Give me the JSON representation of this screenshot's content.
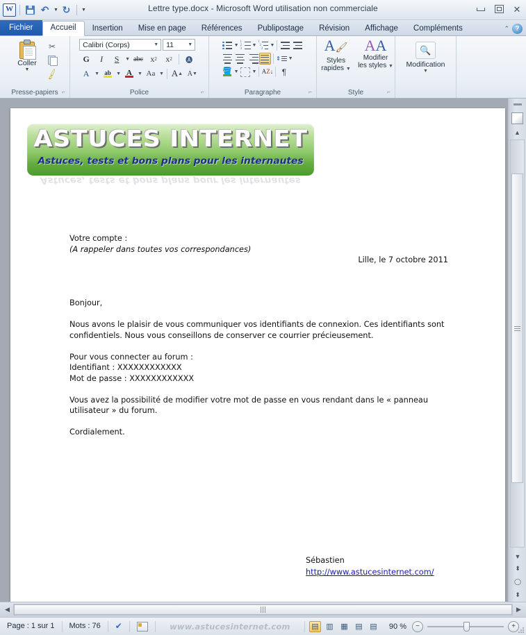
{
  "window": {
    "title": "Lettre type.docx  -  Microsoft Word utilisation non commerciale",
    "app_logo": "word-logo",
    "qat": [
      {
        "name": "save",
        "icon": "save-icon",
        "label": "Enregistrer"
      },
      {
        "name": "undo",
        "icon": "undo-icon",
        "label": "Annuler"
      },
      {
        "name": "redo",
        "icon": "redo-icon",
        "label": "Répéter"
      },
      {
        "name": "customize",
        "icon": "chevron-down-icon",
        "label": "Personnaliser"
      }
    ],
    "controls": {
      "minimize": "—",
      "restore": "❐",
      "close": "✕"
    }
  },
  "tabs": [
    {
      "id": "fichier",
      "label": "Fichier",
      "active": false,
      "file": true
    },
    {
      "id": "accueil",
      "label": "Accueil",
      "active": true
    },
    {
      "id": "insertion",
      "label": "Insertion",
      "active": false
    },
    {
      "id": "mise-en-page",
      "label": "Mise en page",
      "active": false
    },
    {
      "id": "references",
      "label": "Références",
      "active": false
    },
    {
      "id": "publipostage",
      "label": "Publipostage",
      "active": false
    },
    {
      "id": "revision",
      "label": "Révision",
      "active": false
    },
    {
      "id": "affichage",
      "label": "Affichage",
      "active": false
    },
    {
      "id": "complements",
      "label": "Compléments",
      "active": false
    }
  ],
  "help_icon": "?",
  "ribbon": {
    "clipboard": {
      "label": "Presse-papiers",
      "paste": "Coller",
      "cut": "cut-icon",
      "copy": "copy-icon",
      "format_painter": "format-painter-icon"
    },
    "font": {
      "label": "Police",
      "font_name": "Calibri (Corps)",
      "font_size": "11",
      "bold": "G",
      "italic": "I",
      "underline": "S",
      "strikethrough": "abc",
      "subscript": "x₂",
      "superscript": "x²",
      "clear_format": "clear-formatting-icon",
      "text_effects": "A",
      "highlight": "ab",
      "font_color": "A",
      "change_case": "Aa",
      "grow_font": "A",
      "shrink_font": "A"
    },
    "paragraph": {
      "label": "Paragraphe",
      "bullets": "bullet-list-icon",
      "numbering": "numbered-list-icon",
      "multilevel": "multilevel-list-icon",
      "decrease_indent": "decrease-indent-icon",
      "increase_indent": "increase-indent-icon",
      "align_left": "align-left-icon",
      "align_center": "align-center-icon",
      "align_right": "align-right-icon",
      "justify": "justify-icon",
      "line_spacing": "line-spacing-icon",
      "shading": "shading-icon",
      "borders": "borders-icon",
      "sort": "sort-icon",
      "show_marks": "¶"
    },
    "style": {
      "label": "Style",
      "quick_styles_l1": "Styles",
      "quick_styles_l2": "rapides",
      "change_styles_l1": "Modifier",
      "change_styles_l2": "les styles"
    },
    "editing": {
      "label": "",
      "modification": "Modification",
      "icon": "binoculars-icon"
    }
  },
  "document": {
    "logo": {
      "title": "ASTUCES INTERNET",
      "tagline": "Astuces, tests et bons plans pour les internautes"
    },
    "account_line1": "Votre compte :",
    "account_line2": "(A rappeler dans toutes vos correspondances)",
    "date": "Lille, le 7 octobre 2011",
    "greeting": "Bonjour,",
    "para1": "Nous avons le plaisir de vous communiquer vos identifiants de connexion. Ces identifiants sont confidentiels. Nous vous conseillons de conserver ce courrier précieusement.",
    "connect_intro": "Pour vous connecter au forum :",
    "login_line": "Identifiant : XXXXXXXXXXXX",
    "password_line": "Mot de passe : XXXXXXXXXXXX",
    "para2": "Vous avez la possibilité de modifier votre mot de passe en vous rendant dans le « panneau utilisateur » du forum.",
    "closing": "Cordialement.",
    "signature_name": "Sébastien",
    "signature_url": "http://www.astucesinternet.com/"
  },
  "status": {
    "page": "Page : 1 sur 1",
    "words": "Mots : 76",
    "spell_icon": "spell-check-icon",
    "language_icon": "language-icon",
    "watermark": "www.astucesinternet.com",
    "views": [
      {
        "name": "print-layout",
        "icon": "▤",
        "selected": true
      },
      {
        "name": "full-screen-reading",
        "icon": "▥",
        "selected": false
      },
      {
        "name": "web-layout",
        "icon": "▦",
        "selected": false
      },
      {
        "name": "outline",
        "icon": "▤",
        "selected": false
      },
      {
        "name": "draft",
        "icon": "▤",
        "selected": false
      }
    ],
    "zoom": "90 %",
    "zoom_out": "−",
    "zoom_in": "+"
  },
  "colors": {
    "accent": "#2f6bbf",
    "file_tab": "#1f5aa8",
    "highlight": "#f6c76b",
    "link": "#1a1aa8",
    "logo_green": "#63ab3e",
    "logo_blue": "#1c2f8f"
  }
}
